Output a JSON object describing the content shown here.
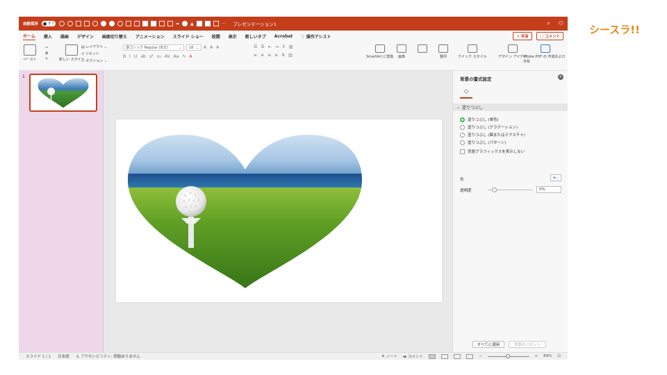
{
  "window": {
    "autosave_label": "自動保存",
    "autosave_state": "オフ",
    "doc_title": "プレゼンテーション1"
  },
  "tabs": [
    "ホーム",
    "挿入",
    "描画",
    "デザイン",
    "画面切り替え",
    "アニメーション",
    "スライド ショー",
    "校閲",
    "表示",
    "新しいタブ",
    "Acrobat",
    "操作アシスト"
  ],
  "tab_actions": {
    "share": "共有",
    "comment": "コメント"
  },
  "ribbon": {
    "paste": "ペースト",
    "new_slide": "新しい スライド",
    "layout": "レイアウト",
    "reset": "リセット",
    "section": "セクション",
    "font_name": "游ゴシック Regular (本文)",
    "font_size": "18",
    "smartart": "SmartArt に変換",
    "picture": "画像",
    "arrange": "整列",
    "quick_styles": "クイック スタイル",
    "design_ideas": "デザイン アイデア",
    "adobe_pdf": "Adobe PDF の 作成および共有"
  },
  "thumbnail": {
    "number": "1"
  },
  "format_pane": {
    "title": "背景の書式設定",
    "section": "塗りつぶし",
    "options": [
      {
        "label": "塗りつぶし (単色)",
        "selected": true
      },
      {
        "label": "塗りつぶし (グラデーション)",
        "selected": false
      },
      {
        "label": "塗りつぶし (図またはテクスチャ)",
        "selected": false
      },
      {
        "label": "塗りつぶし (パターン)",
        "selected": false
      }
    ],
    "hide_bg_graphics": "背景グラフィックスを表示しない",
    "color_label": "色",
    "transparency_label": "透明度",
    "transparency_value": "0%",
    "transparency_level": 0,
    "apply_all": "すべてに適用",
    "reset_background": "背景のリセット"
  },
  "status": {
    "slide": "スライド 1 / 1",
    "language": "日本語",
    "accessibility": "アクセシビリティ: 問題ありません",
    "notes": "ノート",
    "comments": "コメント",
    "zoom": "89%"
  },
  "brand": "シースラ!!"
}
